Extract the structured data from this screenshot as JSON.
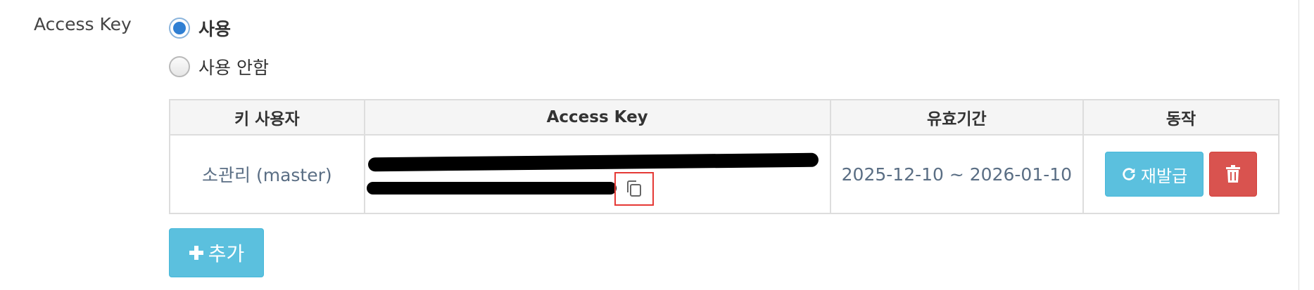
{
  "form": {
    "field_label": "Access Key",
    "options": [
      {
        "label": "사용",
        "checked": true
      },
      {
        "label": "사용 안함",
        "checked": false
      }
    ]
  },
  "table": {
    "headers": [
      "키 사용자",
      "Access Key",
      "유효기간",
      "동작"
    ],
    "rows": [
      {
        "user": "소관리 (master)",
        "validity": "2025-12-10 ~ 2026-01-10",
        "reissue_label": "재발급"
      }
    ]
  },
  "add_button": {
    "label": "추가"
  },
  "icons": {
    "copy": "copy-icon",
    "refresh": "refresh-icon",
    "trash": "trash-icon",
    "plus": "plus-icon"
  },
  "colors": {
    "info": "#5bc0de",
    "danger": "#d9534f",
    "radio_selected": "#2f7fd3",
    "highlight_border": "#e53935"
  }
}
